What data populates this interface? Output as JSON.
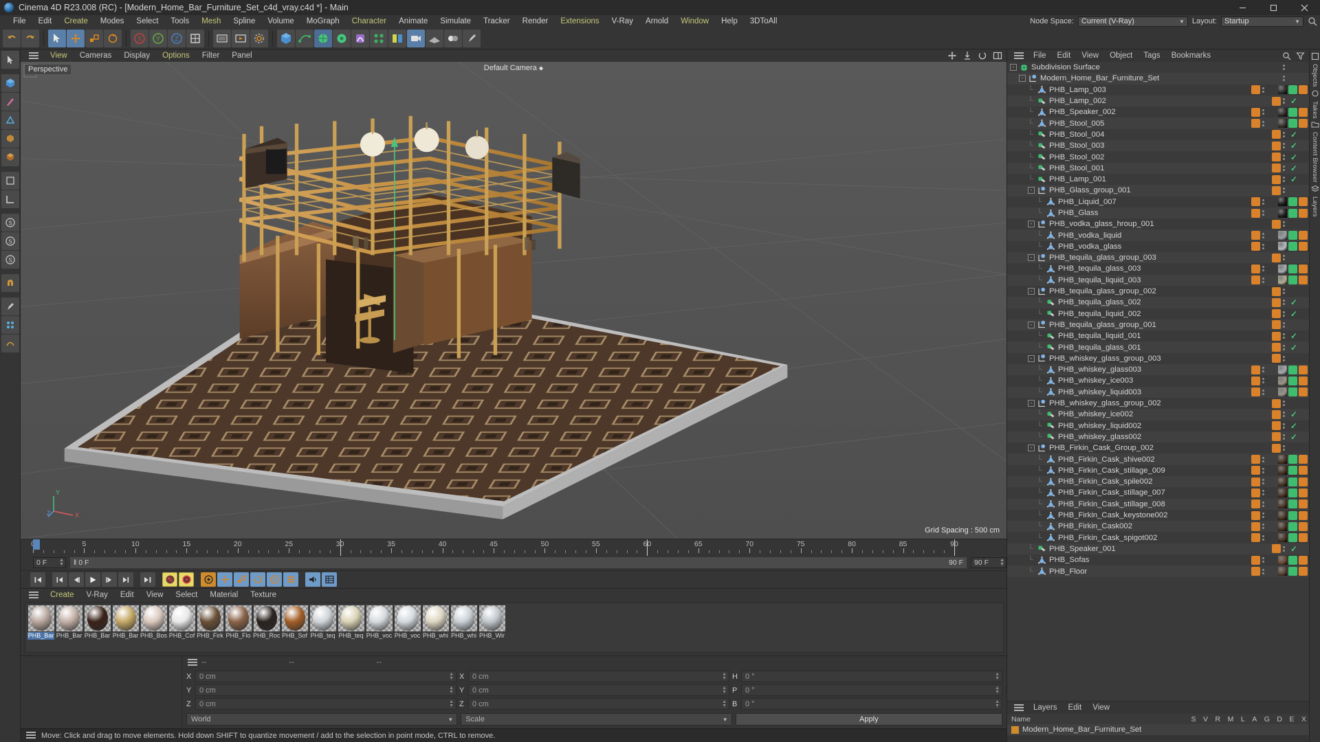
{
  "titlebar": {
    "title": "Cinema 4D R23.008 (RC) - [Modern_Home_Bar_Furniture_Set_c4d_vray.c4d *] - Main",
    "minimize": "—",
    "maximize": "❐",
    "close": "✕"
  },
  "menubar": {
    "items": [
      {
        "label": "File",
        "accent": false
      },
      {
        "label": "Edit",
        "accent": false
      },
      {
        "label": "Create",
        "accent": true
      },
      {
        "label": "Modes",
        "accent": false
      },
      {
        "label": "Select",
        "accent": false
      },
      {
        "label": "Tools",
        "accent": false
      },
      {
        "label": "Mesh",
        "accent": true
      },
      {
        "label": "Spline",
        "accent": false
      },
      {
        "label": "Volume",
        "accent": false
      },
      {
        "label": "MoGraph",
        "accent": false
      },
      {
        "label": "Character",
        "accent": true
      },
      {
        "label": "Animate",
        "accent": false
      },
      {
        "label": "Simulate",
        "accent": false
      },
      {
        "label": "Tracker",
        "accent": false
      },
      {
        "label": "Render",
        "accent": false
      },
      {
        "label": "Extensions",
        "accent": true
      },
      {
        "label": "V-Ray",
        "accent": false
      },
      {
        "label": "Arnold",
        "accent": false
      },
      {
        "label": "Window",
        "accent": true
      },
      {
        "label": "Help",
        "accent": false
      },
      {
        "label": "3DToAll",
        "accent": false
      }
    ],
    "node_space_label": "Node Space:",
    "node_space_value": "Current (V-Ray)",
    "layout_label": "Layout:",
    "layout_value": "Startup"
  },
  "viewport": {
    "menu": [
      {
        "label": "View",
        "accent": true
      },
      {
        "label": "Cameras",
        "accent": false
      },
      {
        "label": "Display",
        "accent": false
      },
      {
        "label": "Options",
        "accent": true
      },
      {
        "label": "Filter",
        "accent": false
      },
      {
        "label": "Panel",
        "accent": false
      }
    ],
    "label": "Perspective",
    "camera": "Default Camera",
    "grid_spacing": "Grid Spacing : 500 cm",
    "axis_x": "X",
    "axis_y": "Y",
    "axis_z": "Z"
  },
  "timeline": {
    "ticks": [
      0,
      5,
      10,
      15,
      20,
      25,
      30,
      35,
      40,
      45,
      50,
      55,
      60,
      65,
      70,
      75,
      80,
      85,
      90
    ],
    "start_frame": "0 F",
    "current_frame_left": "0 F",
    "end_frame_right": "90 F",
    "end_field": "90 F",
    "current_field": "0 F"
  },
  "materials": {
    "menu": [
      {
        "label": "Create",
        "accent": true
      },
      {
        "label": "V-Ray",
        "accent": false
      },
      {
        "label": "Edit",
        "accent": false
      },
      {
        "label": "View",
        "accent": false
      },
      {
        "label": "Select",
        "accent": false
      },
      {
        "label": "Material",
        "accent": false
      },
      {
        "label": "Texture",
        "accent": false
      }
    ],
    "items": [
      {
        "name": "PHB_Bar",
        "color": "#b9a79e",
        "selected": true
      },
      {
        "name": "PHB_Bar",
        "color": "#c2b0a6",
        "selected": false
      },
      {
        "name": "PHB_Bar",
        "color": "#3a2218",
        "selected": false
      },
      {
        "name": "PHB_Bar",
        "color": "#c4a866",
        "selected": false
      },
      {
        "name": "PHB_Bos",
        "color": "#d9c8bd",
        "selected": false
      },
      {
        "name": "PHB_Cof",
        "color": "#e8e8e8",
        "selected": false
      },
      {
        "name": "PHB_Firk",
        "color": "#6a5038",
        "selected": false
      },
      {
        "name": "PHB_Flo",
        "color": "#8a6348",
        "selected": false
      },
      {
        "name": "PHB_Roc",
        "color": "#2a2320",
        "selected": false
      },
      {
        "name": "PHB_Sof",
        "color": "#a35f27",
        "selected": false
      },
      {
        "name": "PHB_teq",
        "color": "#cfd4d8",
        "selected": false
      },
      {
        "name": "PHB_teq",
        "color": "#d9d2b4",
        "selected": false
      },
      {
        "name": "PHB_voc",
        "color": "#d6dade",
        "selected": false
      },
      {
        "name": "PHB_voc",
        "color": "#d4d9dd",
        "selected": false
      },
      {
        "name": "PHB_whi",
        "color": "#ddd6c2",
        "selected": false
      },
      {
        "name": "PHB_whi",
        "color": "#c9d0d6",
        "selected": false
      },
      {
        "name": "PHB_Wir",
        "color": "#c0c6cc",
        "selected": false
      }
    ]
  },
  "objectmanager": {
    "menu": [
      "File",
      "Edit",
      "View",
      "Object",
      "Tags",
      "Bookmarks"
    ],
    "tree": [
      {
        "label": "Subdivision Surface",
        "depth": 0,
        "icon": "subdivision",
        "twisty": "-",
        "check": false,
        "matdot": false,
        "tex": null
      },
      {
        "label": "Modern_Home_Bar_Furniture_Set",
        "depth": 1,
        "icon": "null",
        "twisty": "-",
        "check": false,
        "matdot": false,
        "tex": null
      },
      {
        "label": "PHB_Lamp_003",
        "depth": 2,
        "icon": "poly",
        "twisty": "",
        "check": false,
        "matdot": true,
        "tex": "#2c2c2c"
      },
      {
        "label": "PHB_Lamp_002",
        "depth": 2,
        "icon": "mesh",
        "twisty": "",
        "check": true,
        "matdot": true,
        "tex": null
      },
      {
        "label": "PHB_Speaker_002",
        "depth": 2,
        "icon": "poly",
        "twisty": "",
        "check": false,
        "matdot": true,
        "tex": "#2e2a26"
      },
      {
        "label": "PHB_Stool_005",
        "depth": 2,
        "icon": "poly",
        "twisty": "",
        "check": false,
        "matdot": true,
        "tex": "#3a332c"
      },
      {
        "label": "PHB_Stool_004",
        "depth": 2,
        "icon": "mesh",
        "twisty": "",
        "check": true,
        "matdot": true,
        "tex": null
      },
      {
        "label": "PHB_Stool_003",
        "depth": 2,
        "icon": "mesh",
        "twisty": "",
        "check": true,
        "matdot": true,
        "tex": null
      },
      {
        "label": "PHB_Stool_002",
        "depth": 2,
        "icon": "mesh",
        "twisty": "",
        "check": true,
        "matdot": true,
        "tex": null
      },
      {
        "label": "PHB_Stool_001",
        "depth": 2,
        "icon": "mesh",
        "twisty": "",
        "check": true,
        "matdot": true,
        "tex": null
      },
      {
        "label": "PHB_Lamp_001",
        "depth": 2,
        "icon": "mesh",
        "twisty": "",
        "check": true,
        "matdot": true,
        "tex": null
      },
      {
        "label": "PHB_Glass_group_001",
        "depth": 2,
        "icon": "null",
        "twisty": "-",
        "check": false,
        "matdot": true,
        "tex": null
      },
      {
        "label": "PHB_Liquid_007",
        "depth": 3,
        "icon": "poly",
        "twisty": "",
        "check": false,
        "matdot": true,
        "tex": "#191919"
      },
      {
        "label": "PHB_Glass",
        "depth": 3,
        "icon": "poly",
        "twisty": "",
        "check": false,
        "matdot": true,
        "tex": "#1c1c1c"
      },
      {
        "label": "PHB_vodka_glass_hroup_001",
        "depth": 2,
        "icon": "null",
        "twisty": "-",
        "check": false,
        "matdot": true,
        "tex": null
      },
      {
        "label": "PHB_vodka_liquid",
        "depth": 3,
        "icon": "poly",
        "twisty": "",
        "check": false,
        "matdot": true,
        "tex": "#9aa0a4"
      },
      {
        "label": "PHB_vodka_glass",
        "depth": 3,
        "icon": "poly",
        "twisty": "",
        "check": false,
        "matdot": true,
        "tex": "#b6bcc0"
      },
      {
        "label": "PHB_tequila_glass_group_003",
        "depth": 2,
        "icon": "null",
        "twisty": "-",
        "check": false,
        "matdot": true,
        "tex": null
      },
      {
        "label": "PHB_tequila_glass_003",
        "depth": 3,
        "icon": "poly",
        "twisty": "",
        "check": false,
        "matdot": true,
        "tex": "#a9adb0"
      },
      {
        "label": "PHB_tequila_liquid_003",
        "depth": 3,
        "icon": "poly",
        "twisty": "",
        "check": false,
        "matdot": true,
        "tex": "#b5ae92"
      },
      {
        "label": "PHB_tequila_glass_group_002",
        "depth": 2,
        "icon": "null",
        "twisty": "-",
        "check": false,
        "matdot": true,
        "tex": null
      },
      {
        "label": "PHB_tequila_glass_002",
        "depth": 3,
        "icon": "mesh",
        "twisty": "",
        "check": true,
        "matdot": true,
        "tex": null
      },
      {
        "label": "PHB_tequila_liquid_002",
        "depth": 3,
        "icon": "mesh",
        "twisty": "",
        "check": true,
        "matdot": true,
        "tex": null
      },
      {
        "label": "PHB_tequila_glass_group_001",
        "depth": 2,
        "icon": "null",
        "twisty": "-",
        "check": false,
        "matdot": true,
        "tex": null
      },
      {
        "label": "PHB_tequila_liquid_001",
        "depth": 3,
        "icon": "mesh",
        "twisty": "",
        "check": true,
        "matdot": true,
        "tex": null
      },
      {
        "label": "PHB_tequila_glass_001",
        "depth": 3,
        "icon": "mesh",
        "twisty": "",
        "check": true,
        "matdot": true,
        "tex": null
      },
      {
        "label": "PHB_whiskey_glass_group_003",
        "depth": 2,
        "icon": "null",
        "twisty": "-",
        "check": false,
        "matdot": true,
        "tex": null
      },
      {
        "label": "PHB_whiskey_glass003",
        "depth": 3,
        "icon": "poly",
        "twisty": "",
        "check": false,
        "matdot": true,
        "tex": "#a6aaad"
      },
      {
        "label": "PHB_whiskey_ice003",
        "depth": 3,
        "icon": "poly",
        "twisty": "",
        "check": false,
        "matdot": true,
        "tex": "#9d9685"
      },
      {
        "label": "PHB_whiskey_liquid003",
        "depth": 3,
        "icon": "poly",
        "twisty": "",
        "check": false,
        "matdot": true,
        "tex": "#9a948a"
      },
      {
        "label": "PHB_whiskey_glass_group_002",
        "depth": 2,
        "icon": "null",
        "twisty": "-",
        "check": false,
        "matdot": true,
        "tex": null
      },
      {
        "label": "PHB_whiskey_ice002",
        "depth": 3,
        "icon": "mesh",
        "twisty": "",
        "check": true,
        "matdot": true,
        "tex": null
      },
      {
        "label": "PHB_whiskey_liquid002",
        "depth": 3,
        "icon": "mesh",
        "twisty": "",
        "check": true,
        "matdot": true,
        "tex": null
      },
      {
        "label": "PHB_whiskey_glass002",
        "depth": 3,
        "icon": "mesh",
        "twisty": "",
        "check": true,
        "matdot": true,
        "tex": null
      },
      {
        "label": "PHB_Firkin_Cask_Group_002",
        "depth": 2,
        "icon": "null",
        "twisty": "-",
        "check": false,
        "matdot": true,
        "tex": null
      },
      {
        "label": "PHB_Firkin_Cask_shive002",
        "depth": 3,
        "icon": "poly",
        "twisty": "",
        "check": false,
        "matdot": true,
        "tex": "#4a3524"
      },
      {
        "label": "PHB_Firkin_Cask_stillage_009",
        "depth": 3,
        "icon": "poly",
        "twisty": "",
        "check": false,
        "matdot": true,
        "tex": "#4a3524"
      },
      {
        "label": "PHB_Firkin_Cask_spile002",
        "depth": 3,
        "icon": "poly",
        "twisty": "",
        "check": false,
        "matdot": true,
        "tex": "#4a3524"
      },
      {
        "label": "PHB_Firkin_Cask_stillage_007",
        "depth": 3,
        "icon": "poly",
        "twisty": "",
        "check": false,
        "matdot": true,
        "tex": "#4a3524"
      },
      {
        "label": "PHB_Firkin_Cask_stillage_008",
        "depth": 3,
        "icon": "poly",
        "twisty": "",
        "check": false,
        "matdot": true,
        "tex": "#4a3524"
      },
      {
        "label": "PHB_Firkin_Cask_keystone002",
        "depth": 3,
        "icon": "poly",
        "twisty": "",
        "check": false,
        "matdot": true,
        "tex": "#4a3524"
      },
      {
        "label": "PHB_Firkin_Cask002",
        "depth": 3,
        "icon": "poly",
        "twisty": "",
        "check": false,
        "matdot": true,
        "tex": "#4a3524"
      },
      {
        "label": "PHB_Firkin_Cask_spigot002",
        "depth": 3,
        "icon": "poly",
        "twisty": "",
        "check": false,
        "matdot": true,
        "tex": "#4a3524"
      },
      {
        "label": "PHB_Speaker_001",
        "depth": 2,
        "icon": "mesh",
        "twisty": "",
        "check": true,
        "matdot": true,
        "tex": null
      },
      {
        "label": "PHB_Sofas",
        "depth": 2,
        "icon": "poly",
        "twisty": "",
        "check": false,
        "matdot": true,
        "tex": "#6d4a33"
      },
      {
        "label": "PHB_Floor",
        "depth": 2,
        "icon": "poly",
        "twisty": "",
        "check": false,
        "matdot": true,
        "tex": "#5a4334"
      }
    ]
  },
  "layers": {
    "menu": [
      "Layers",
      "Edit",
      "View"
    ],
    "name_header": "Name",
    "columns": [
      "S",
      "V",
      "R",
      "M",
      "L",
      "A",
      "G",
      "D",
      "E",
      "X"
    ],
    "rows": [
      {
        "name": "Modern_Home_Bar_Furniture_Set",
        "color": "#d08b2a"
      }
    ]
  },
  "coordinates": {
    "header": [
      "--",
      "--",
      "--"
    ],
    "rows": [
      {
        "pos_label": "X",
        "pos": "0 cm",
        "size_label": "X",
        "size": "0 cm",
        "rot_label": "H",
        "rot": "0 °"
      },
      {
        "pos_label": "Y",
        "pos": "0 cm",
        "size_label": "Y",
        "size": "0 cm",
        "rot_label": "P",
        "rot": "0 °"
      },
      {
        "pos_label": "Z",
        "pos": "0 cm",
        "size_label": "Z",
        "size": "0 cm",
        "rot_label": "B",
        "rot": "0 °"
      }
    ],
    "coord_system": "World",
    "mode": "Scale",
    "apply": "Apply"
  },
  "status": {
    "message": "Move: Click and drag to move elements. Hold down SHIFT to quantize movement / add to the selection in point mode, CTRL to remove."
  },
  "farright": {
    "tabs": [
      "Objects",
      "Takes",
      "Content Browser",
      "Layers"
    ]
  },
  "colors": {
    "accent_menu": "#c6c87a",
    "tag_orange": "#d9822b",
    "check_green": "#49c47e",
    "tool_blue": "#5a7fa8",
    "panel_bg": "#353535",
    "list_bg": "#3a3a3a",
    "list_alt": "#404040"
  }
}
